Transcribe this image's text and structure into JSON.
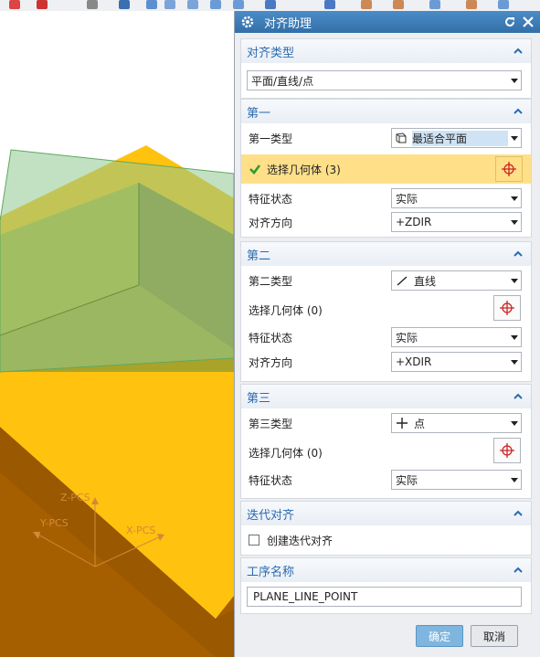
{
  "dialog": {
    "title": "对齐助理"
  },
  "align_type": {
    "header": "对齐类型",
    "value": "平面/直线/点"
  },
  "first": {
    "header": "第一",
    "type_label": "第一类型",
    "type_value": "最适合平面",
    "select_label": "选择几何体 (3)",
    "state_label": "特征状态",
    "state_value": "实际",
    "dir_label": "对齐方向",
    "dir_value": "+ZDIR"
  },
  "second": {
    "header": "第二",
    "type_label": "第二类型",
    "type_value": "直线",
    "select_label": "选择几何体 (0)",
    "state_label": "特征状态",
    "state_value": "实际",
    "dir_label": "对齐方向",
    "dir_value": "+XDIR"
  },
  "third": {
    "header": "第三",
    "type_label": "第三类型",
    "type_value": "点",
    "select_label": "选择几何体 (0)",
    "state_label": "特征状态",
    "state_value": "实际"
  },
  "iterative": {
    "header": "迭代对齐",
    "checkbox_label": "创建迭代对齐",
    "checked": false
  },
  "operation": {
    "header": "工序名称",
    "value": "PLANE_LINE_POINT"
  },
  "buttons": {
    "ok": "确定",
    "cancel": "取消"
  },
  "viewport": {
    "axis_z": "Z-PCS",
    "axis_y": "Y-PCS",
    "axis_x": "X-PCS"
  },
  "colors": {
    "title_bar": "#3a7ab7",
    "section_header_text": "#2a6bb0",
    "selection_highlight": "#ffe089",
    "ok_button": "#7fb6df",
    "part_top": "#ffc20e",
    "part_side": "#a65f00",
    "plane_fill": "#8fc98f",
    "axis_color": "#d28a3a"
  }
}
